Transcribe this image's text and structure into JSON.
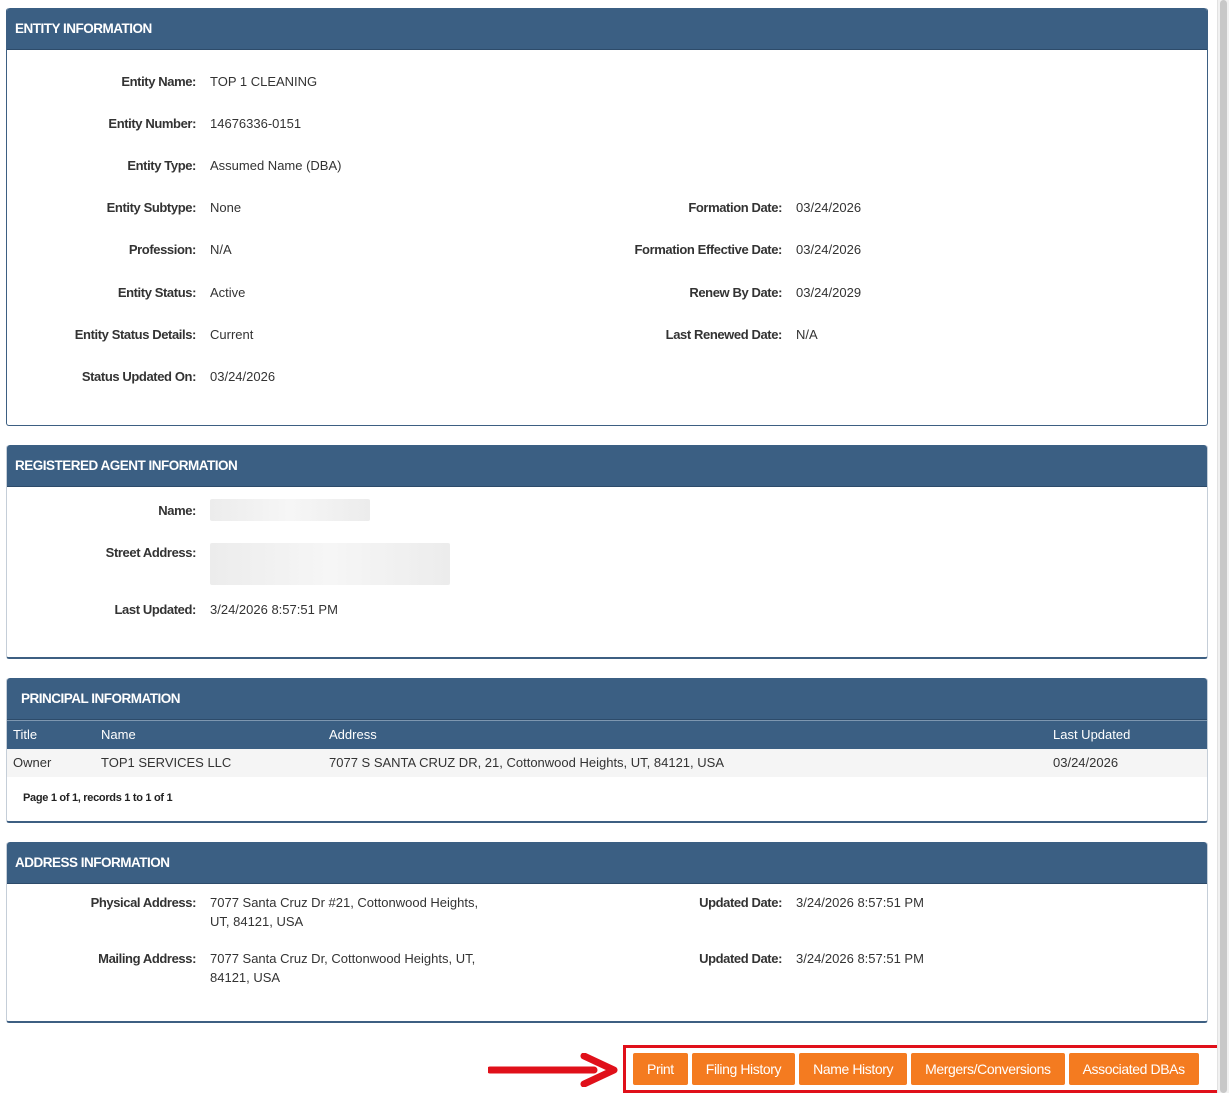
{
  "entity": {
    "header": "ENTITY INFORMATION",
    "left": [
      {
        "label": "Entity Name:",
        "value": "TOP 1 CLEANING"
      },
      {
        "label": "Entity Number:",
        "value": "14676336-0151"
      },
      {
        "label": "Entity Type:",
        "value": "Assumed Name (DBA)"
      },
      {
        "label": "Entity Subtype:",
        "value": "None"
      },
      {
        "label": "Profession:",
        "value": "N/A"
      },
      {
        "label": "Entity Status:",
        "value": "Active"
      },
      {
        "label": "Entity Status Details:",
        "value": "Current"
      },
      {
        "label": "Status Updated On:",
        "value": "03/24/2026"
      }
    ],
    "right": [
      {
        "label": "Formation Date:",
        "value": "03/24/2026"
      },
      {
        "label": "Formation Effective Date:",
        "value": "03/24/2026"
      },
      {
        "label": "Renew By Date:",
        "value": "03/24/2029"
      },
      {
        "label": "Last Renewed Date:",
        "value": "N/A"
      }
    ]
  },
  "agent": {
    "header": "REGISTERED AGENT INFORMATION",
    "name_label": "Name:",
    "street_label": "Street Address:",
    "updated_label": "Last Updated:",
    "updated_value": "3/24/2026 8:57:51 PM"
  },
  "principal": {
    "header": "PRINCIPAL INFORMATION",
    "columns": [
      "Title",
      "Name",
      "Address",
      "Last Updated"
    ],
    "rows": [
      [
        "Owner",
        "TOP1 SERVICES LLC",
        "7077 S SANTA CRUZ DR, 21, Cottonwood Heights, UT, 84121, USA",
        "03/24/2026"
      ]
    ],
    "pager": "Page 1 of 1, records 1 to 1 of 1"
  },
  "address": {
    "header": "ADDRESS INFORMATION",
    "physical_label": "Physical Address:",
    "physical_line1": "7077 Santa Cruz Dr #21, Cottonwood Heights,",
    "physical_line2": "UT, 84121, USA",
    "mailing_label": "Mailing Address:",
    "mailing_line1": "7077 Santa Cruz Dr, Cottonwood Heights, UT,",
    "mailing_line2": "84121, USA",
    "updated_label": "Updated Date:",
    "physical_updated": "3/24/2026 8:57:51 PM",
    "mailing_updated": "3/24/2026 8:57:51 PM"
  },
  "actions": {
    "print": "Print",
    "filing_history": "Filing History",
    "name_history": "Name History",
    "mergers": "Mergers/Conversions",
    "associated_dbas": "Associated DBAs"
  },
  "colors": {
    "header_bg": "#3b5f83",
    "button_bg": "#f47b20",
    "highlight": "#e0101a"
  },
  "icons": {
    "annotation": "arrow-right-icon"
  }
}
